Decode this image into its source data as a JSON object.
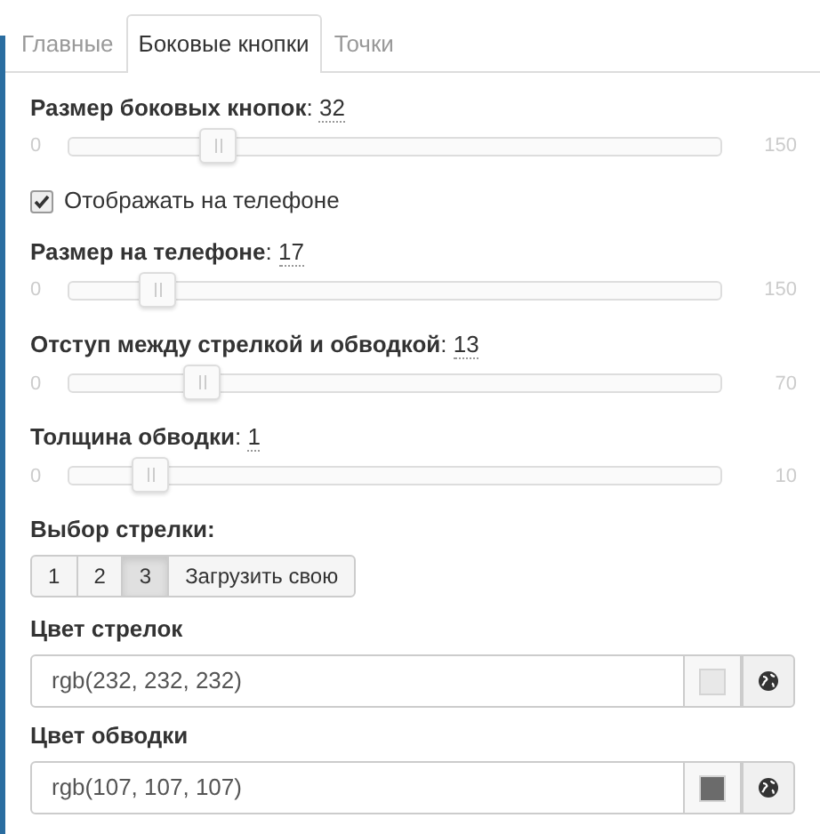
{
  "tabs": [
    {
      "label": "Главные",
      "selected": false
    },
    {
      "label": "Боковые кнопки",
      "selected": true
    },
    {
      "label": "Точки",
      "selected": false
    }
  ],
  "settings": [
    {
      "kind": "slider",
      "label": "Размер боковых кнопок",
      "colon": ":",
      "value": "32",
      "min": "0",
      "max": "150",
      "level": 0.213
    },
    {
      "kind": "checkbox",
      "label": "Отображать на телефоне",
      "checked": true
    },
    {
      "kind": "slider",
      "label": "Размер на телефоне",
      "colon": ":",
      "value": "17",
      "min": "0",
      "max": "150",
      "level": 0.113
    },
    {
      "kind": "slider",
      "label": "Отступ между стрелкой и обводкой",
      "colon": ":",
      "value": "13",
      "min": "0",
      "max": "70",
      "level": 0.186
    },
    {
      "kind": "slider",
      "label": "Толщина обводки",
      "colon": ":",
      "value": "1",
      "min": "0",
      "max": "10",
      "level": 0.1
    },
    {
      "kind": "choice",
      "label": "Выбор стрелки:",
      "options": [
        {
          "label": "1",
          "selected": false
        },
        {
          "label": "2",
          "selected": false
        },
        {
          "label": "3",
          "selected": true
        },
        {
          "label": "Загрузить свою",
          "selected": false
        }
      ]
    },
    {
      "kind": "color",
      "label": "Цвет стрелок",
      "value": "rgb(232, 232, 232)",
      "color": "#e8e8e8"
    },
    {
      "kind": "color",
      "label": "Цвет обводки",
      "value": "rgb(107, 107, 107)",
      "color": "#6b6b6b"
    }
  ]
}
